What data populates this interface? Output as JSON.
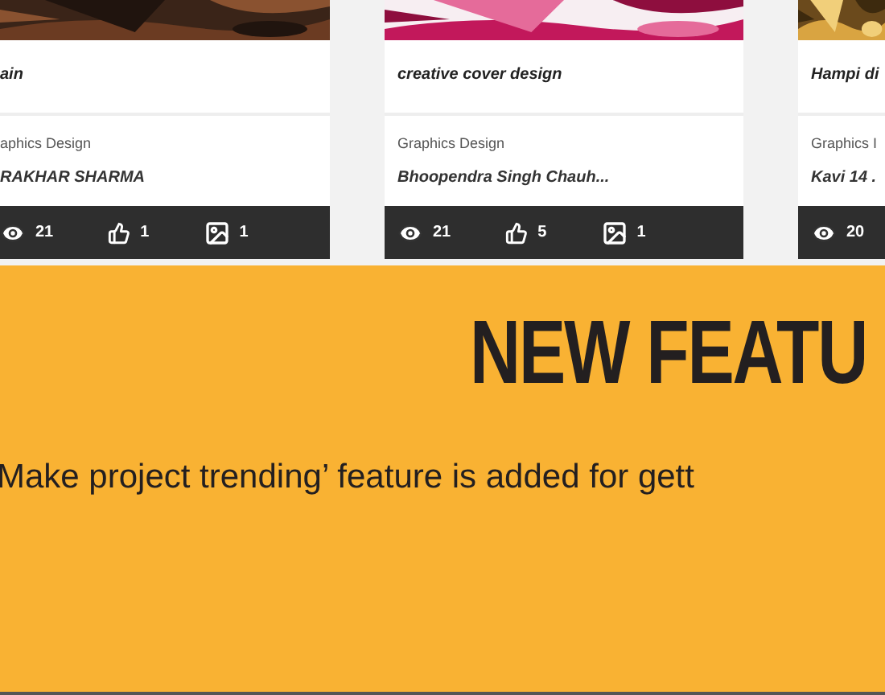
{
  "cards": [
    {
      "title": "ain",
      "category": "aphics Design",
      "author": "RAKHAR SHARMA",
      "stats": [
        {
          "kind": "views",
          "value": "21"
        },
        {
          "kind": "likes",
          "value": "1"
        },
        {
          "kind": "images",
          "value": "1"
        }
      ]
    },
    {
      "title": "creative cover design",
      "category": "Graphics Design",
      "author": "Bhoopendra Singh Chauh...",
      "stats": [
        {
          "kind": "views",
          "value": "21"
        },
        {
          "kind": "likes",
          "value": "5"
        },
        {
          "kind": "images",
          "value": "1"
        }
      ]
    },
    {
      "title": "Hampi di",
      "category": "Graphics I",
      "author": "Kavi 14 .",
      "stats": [
        {
          "kind": "views",
          "value": "20"
        }
      ]
    }
  ],
  "banner": {
    "heading": "NEW FEATU",
    "text": "Make project trending’ feature is added for gett"
  }
}
